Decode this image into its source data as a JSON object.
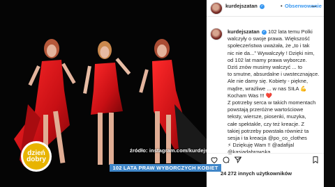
{
  "post": {
    "username": "kurdejszatan",
    "follow_separator": "•",
    "follow_label": "Obserwowanie",
    "more_label": "...",
    "caption_lines": [
      "102 lata temu Polki",
      "walczyły o swoje prawa. Większość",
      "społeczeństwa uważała, że „to i tak",
      "nic nie da...” Wywalczyły ! Dzięki nim,",
      "od 102 lat mamy prawa wyborcze.",
      "Dziś znów musimy walczyć ... to",
      "to smutne, absurdalne i uwstecznające.",
      "Ale nie damy się. Kobiety - piękne,",
      "mądre, wrażliwe ... w nas SIŁA 💪",
      "Kocham Was !!! ❤️",
      "Z potrzeby serca w takich momentach",
      "powstają przeróżne wartościowe",
      "teksty, wiersze, piosenki, muzyka,",
      "całe spektakle, czy też kreacje. Z",
      "takiej potrzeby powstała również ta",
      "sesja i ta kreacja @po_co_clothes",
      "⚡ Dziękuję Wam !! @adafijal",
      "@kasiadabrowska"
    ],
    "likes_text": "24 272 innych użytkowników"
  },
  "overlay": {
    "source_text": "źródło: instagram.com/kurdejszatan",
    "lower_third": "102 LATA PRAW WYBORCZYCH KOBIET",
    "logo_line1": "dzień",
    "logo_line2": "dobry"
  },
  "icons": [
    "verified-badge-icon",
    "heart-icon",
    "comment-icon",
    "share-icon",
    "bookmark-icon"
  ],
  "colors": {
    "follow": "#3897f0",
    "lower_third": "#3f86c8",
    "logo": "#e8b400",
    "dress": "#d11a1a"
  }
}
